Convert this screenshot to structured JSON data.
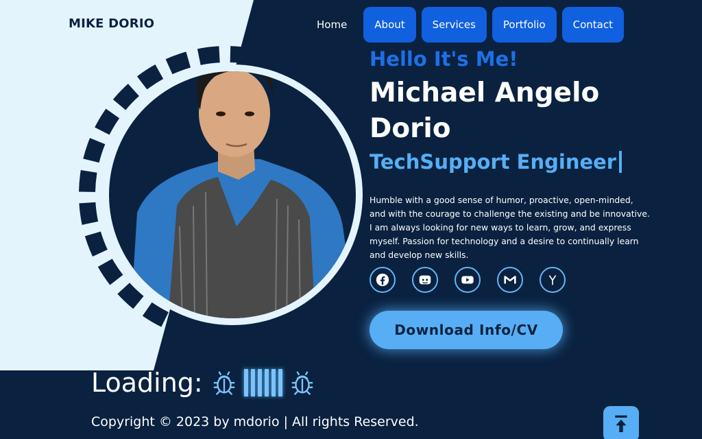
{
  "brand": "MIKE DORIO",
  "nav": {
    "items": [
      {
        "label": "Home"
      },
      {
        "label": "About"
      },
      {
        "label": "Services"
      },
      {
        "label": "Portfolio"
      },
      {
        "label": "Contact"
      }
    ]
  },
  "hero": {
    "greeting": "Hello It's Me!",
    "name": "Michael Angelo Dorio",
    "role": "TechSupport Engineer",
    "bio": "Humble with a good sense of humor, proactive, open-minded, and with the courage to challenge the existing and be innovative. I am always looking for new ways to learn, grow, and express myself. Passion for technology and a desire to continually learn and develop new skills.",
    "cv_button": "Download Info/CV"
  },
  "socials": [
    "facebook-icon",
    "discord-icon",
    "youtube-icon",
    "gmail-icon",
    "ycombinator-icon"
  ],
  "loading": {
    "label": "Loading:"
  },
  "footer": {
    "copyright": "Copyright © 2023 by mdorio | All rights Reserved."
  },
  "colors": {
    "background": "#0a2240",
    "light_panel": "#e4f4fd",
    "accent_blue": "#1060e0",
    "accent_light": "#57aef4"
  }
}
